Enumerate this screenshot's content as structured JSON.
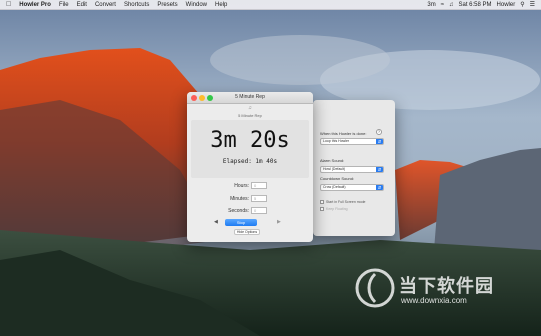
{
  "menubar": {
    "apple": "",
    "app_name": "Howler Pro",
    "items": [
      "File",
      "Edit",
      "Convert",
      "Shortcuts",
      "Presets",
      "Window",
      "Help"
    ],
    "status": {
      "battery": "3m",
      "clock": "Sat 6:58 PM",
      "app": "Howler"
    }
  },
  "main_window": {
    "title": "5 Minute Rep",
    "subtitle": "5 Minute Rep",
    "remaining": "3m 20s",
    "elapsed": "Elapsed: 1m 40s",
    "hours_label": "Hours:",
    "hours_value": "0",
    "minutes_label": "Minutes:",
    "minutes_value": "5",
    "seconds_label": "Seconds:",
    "seconds_value": "0",
    "start_button": "Stop",
    "hide_options": "Hide Options"
  },
  "prefs_window": {
    "when_done_label": "When this Howler is done:",
    "when_done_value": "Loop this Howler",
    "alarm_sound_label": "Alarm Sound:",
    "alarm_sound_value": "Howl (Default)",
    "countdown_sound_label": "Countdown Sound:",
    "countdown_sound_value": "Crow (Default)",
    "fullscreen_label": "Start in Full Screen mode",
    "always_on_top_label": "Keep Floating"
  },
  "watermark": {
    "text": "当下软件园",
    "url": "www.downxia.com"
  },
  "colors": {
    "accent": "#1f7cf2",
    "close": "#fc5f57",
    "minimize": "#fdbc2e",
    "zoom": "#33c748"
  }
}
